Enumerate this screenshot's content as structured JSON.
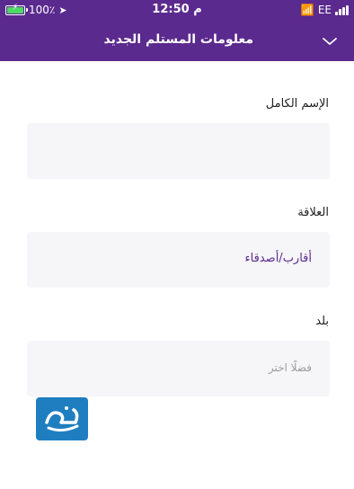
{
  "status_bar": {
    "battery": "100٪",
    "time": "12:50 م",
    "carrier": "EE"
  },
  "header": {
    "title": "معلومات المستلم الجديد"
  },
  "form": {
    "full_name": {
      "label": "الإسم الكامل",
      "value": ""
    },
    "relation": {
      "label": "العلاقة",
      "value": "أقارب/أصدقاء"
    },
    "country": {
      "label": "بلد",
      "placeholder": "فضلًا اختر"
    }
  },
  "colors": {
    "primary": "#5b2a8e",
    "field_bg": "#f6f5f8"
  }
}
